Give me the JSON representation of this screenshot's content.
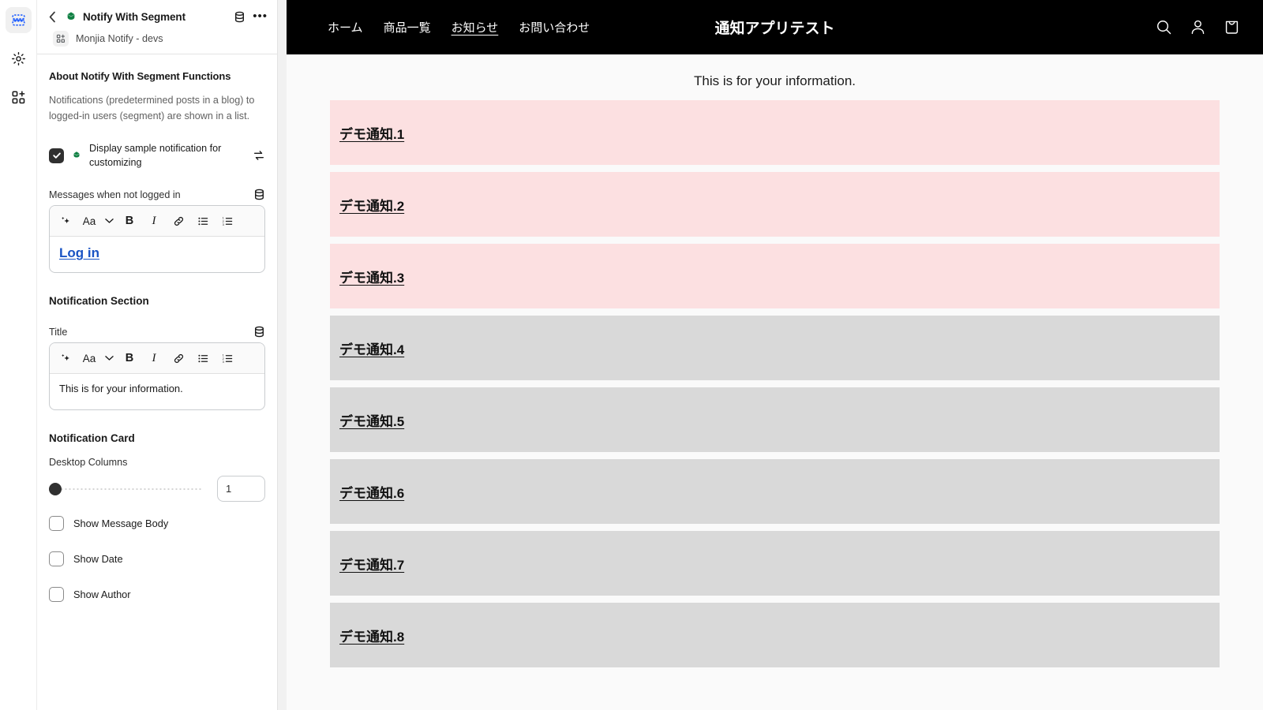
{
  "rail": {
    "items": [
      {
        "name": "sections-icon",
        "label": "Sections"
      },
      {
        "name": "settings-gear-icon",
        "label": "Settings"
      },
      {
        "name": "app-blocks-icon",
        "label": "Apps"
      }
    ]
  },
  "sidebar": {
    "back_label": "Back",
    "title": "Notify With Segment",
    "subtitle": "Monjia Notify - devs",
    "about": {
      "heading": "About Notify With Segment Functions",
      "description": "Notifications (predetermined posts in a blog) to logged-in users (segment) are shown in a list."
    },
    "sample_checkbox": {
      "label": "Display sample notification for customizing",
      "checked": true
    },
    "not_logged_in": {
      "label": "Messages when not logged in",
      "content": "Log in"
    },
    "notification_section": {
      "heading": "Notification Section",
      "title_label": "Title",
      "title_value": "This is for your information."
    },
    "notification_card": {
      "heading": "Notification Card",
      "columns_label": "Desktop Columns",
      "columns_value": "1",
      "checkboxes": [
        {
          "label": "Show Message Body",
          "checked": false
        },
        {
          "label": "Show Date",
          "checked": false
        },
        {
          "label": "Show Author",
          "checked": false
        }
      ]
    },
    "toolbar_icons": [
      "magic-sparkle-icon",
      "text-style-icon",
      "chevron-down-icon",
      "bold-icon",
      "italic-icon",
      "link-icon",
      "bulleted-list-icon",
      "numbered-list-icon"
    ],
    "toolbar_labels": {
      "text_style": "Aa",
      "bold": "B",
      "italic": "I"
    }
  },
  "preview": {
    "nav": {
      "links": [
        {
          "label": "ホーム",
          "active": false
        },
        {
          "label": "商品一覧",
          "active": false
        },
        {
          "label": "お知らせ",
          "active": true
        },
        {
          "label": "お問い合わせ",
          "active": false
        }
      ],
      "store_title": "通知アプリテスト",
      "icons": [
        "search-icon",
        "account-icon",
        "cart-icon"
      ]
    },
    "notice_title": "This is for your information.",
    "cards": [
      {
        "label": "デモ通知.1",
        "color": "#fce0e1"
      },
      {
        "label": "デモ通知.2",
        "color": "#fce0e1"
      },
      {
        "label": "デモ通知.3",
        "color": "#fce0e1"
      },
      {
        "label": "デモ通知.4",
        "color": "#d9d9d9"
      },
      {
        "label": "デモ通知.5",
        "color": "#d9d9d9"
      },
      {
        "label": "デモ通知.6",
        "color": "#d9d9d9"
      },
      {
        "label": "デモ通知.7",
        "color": "#d9d9d9"
      },
      {
        "label": "デモ通知.8",
        "color": "#d9d9d9"
      }
    ]
  },
  "colors": {
    "nav_background": "#000000",
    "pink_card": "#fce0e1",
    "gray_card": "#d9d9d9",
    "accent_blue": "#1a54c4",
    "gem_green": "#108043",
    "page_background": "#fafafa"
  }
}
